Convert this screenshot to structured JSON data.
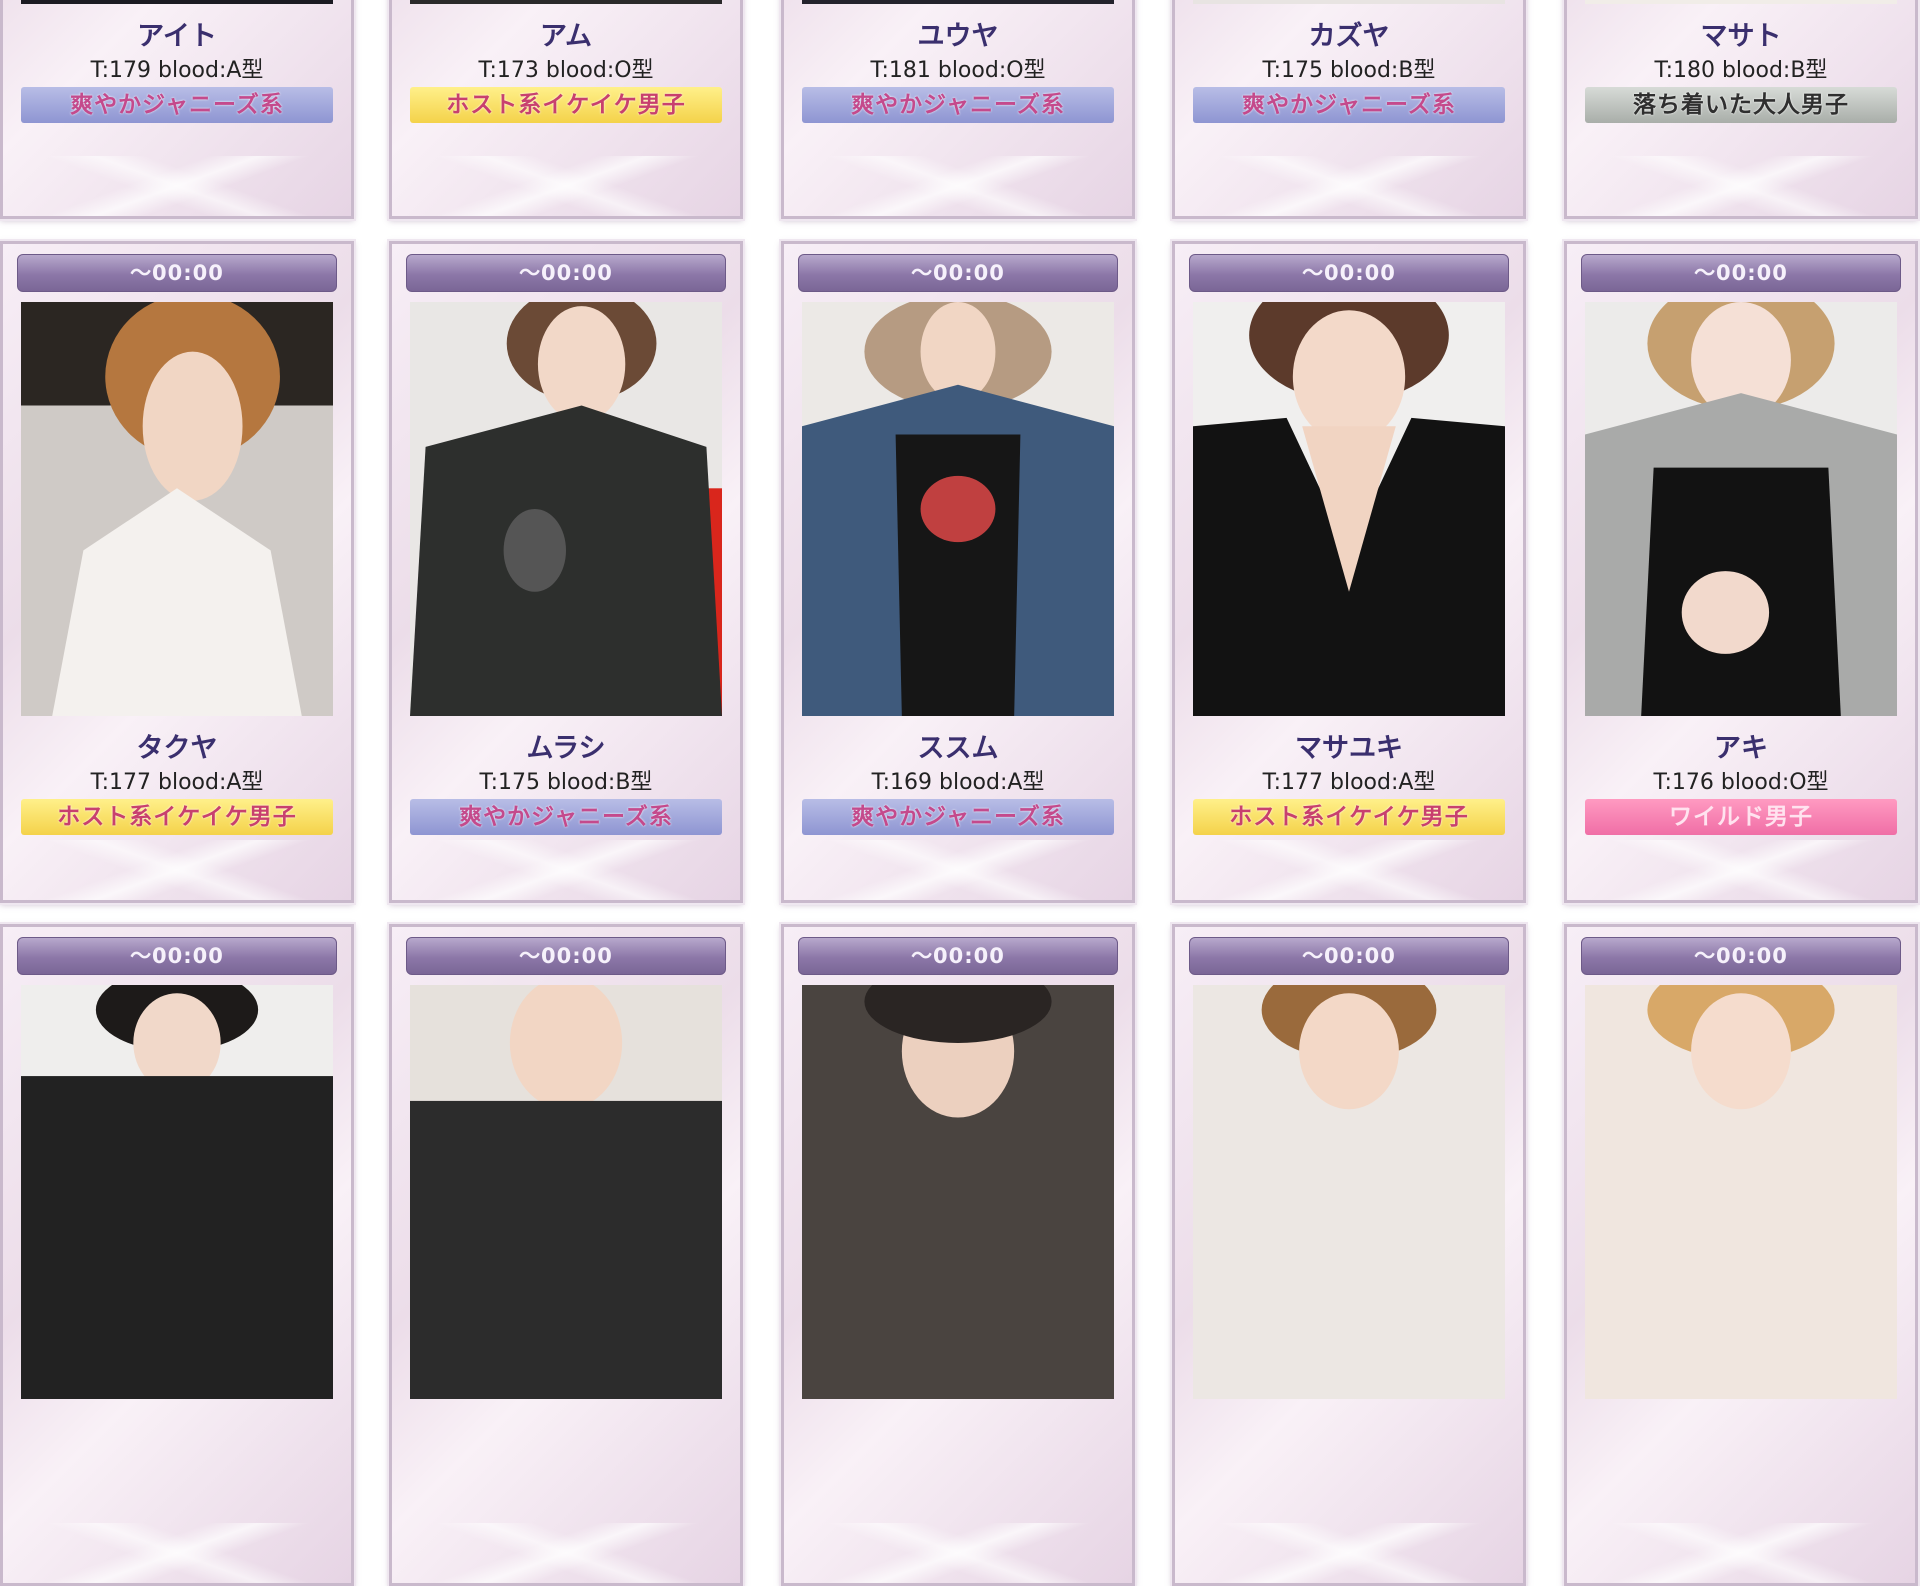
{
  "top_row": [
    {
      "name": "アイト",
      "stats": "T:179 blood:A型",
      "tag": "爽やかジャニーズ系",
      "tag_style": "janis"
    },
    {
      "name": "アム",
      "stats": "T:173 blood:O型",
      "tag": "ホスト系イケイケ男子",
      "tag_style": "host"
    },
    {
      "name": "ユウヤ",
      "stats": "T:181 blood:O型",
      "tag": "爽やかジャニーズ系",
      "tag_style": "janis"
    },
    {
      "name": "カズヤ",
      "stats": "T:175 blood:B型",
      "tag": "爽やかジャニーズ系",
      "tag_style": "janis"
    },
    {
      "name": "マサト",
      "stats": "T:180 blood:B型",
      "tag": "落ち着いた大人男子",
      "tag_style": "adult"
    }
  ],
  "mid_row": [
    {
      "time": "〜00:00",
      "name": "タクヤ",
      "stats": "T:177 blood:A型",
      "tag": "ホスト系イケイケ男子",
      "tag_style": "host"
    },
    {
      "time": "〜00:00",
      "name": "ムラシ",
      "stats": "T:175 blood:B型",
      "tag": "爽やかジャニーズ系",
      "tag_style": "janis"
    },
    {
      "time": "〜00:00",
      "name": "ススム",
      "stats": "T:169 blood:A型",
      "tag": "爽やかジャニーズ系",
      "tag_style": "janis"
    },
    {
      "time": "〜00:00",
      "name": "マサユキ",
      "stats": "T:177 blood:A型",
      "tag": "ホスト系イケイケ男子",
      "tag_style": "host"
    },
    {
      "time": "〜00:00",
      "name": "アキ",
      "stats": "T:176 blood:O型",
      "tag": "ワイルド男子",
      "tag_style": "pink"
    }
  ],
  "bot_row": [
    {
      "time": "〜00:00"
    },
    {
      "time": "〜00:00"
    },
    {
      "time": "〜00:00"
    },
    {
      "time": "〜00:00"
    },
    {
      "time": "〜00:00"
    }
  ],
  "colors": {
    "timebar": "#8c77a8",
    "name_text": "#3a2f6e",
    "card_bg": "#f3e8f1"
  }
}
